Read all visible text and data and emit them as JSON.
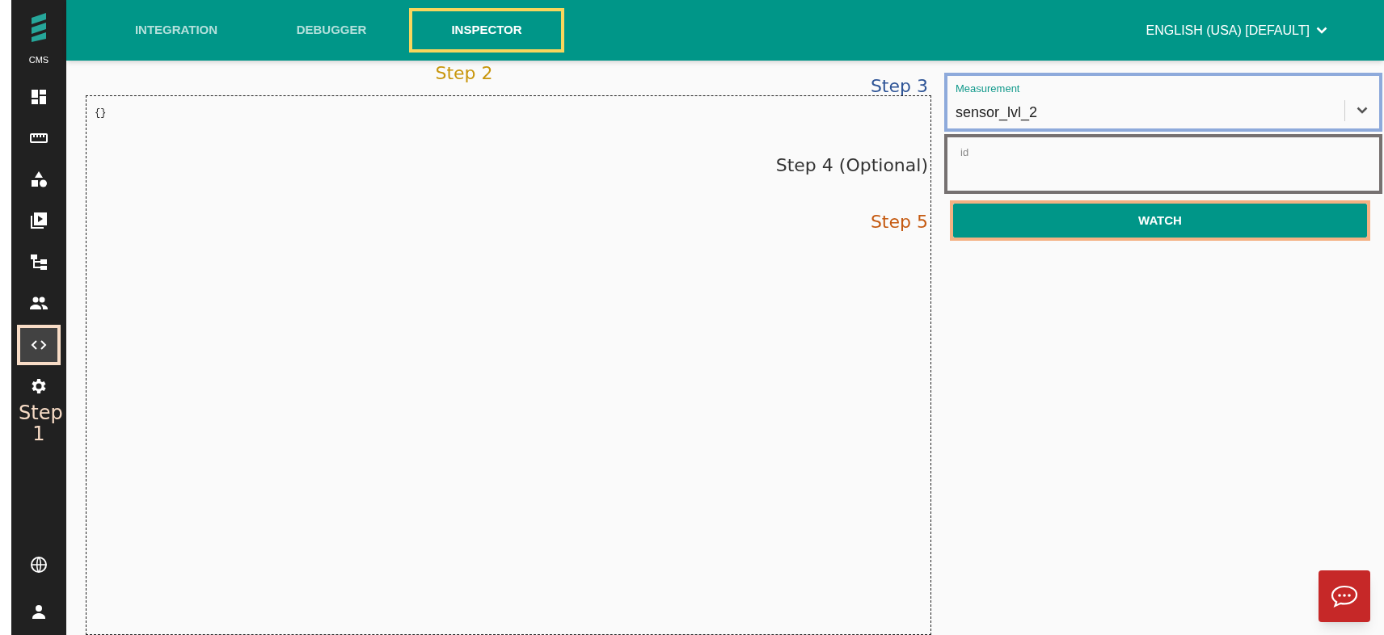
{
  "sidebar": {
    "logo_text": "CMS",
    "items": [
      {
        "selected": false
      },
      {
        "selected": false
      },
      {
        "selected": false
      },
      {
        "selected": false
      },
      {
        "selected": false
      },
      {
        "selected": false
      },
      {
        "selected": true
      },
      {
        "selected": false
      }
    ],
    "bottom_items": [
      {
        "selected": false
      },
      {
        "selected": false
      }
    ]
  },
  "tabs": [
    {
      "label": "INTEGRATION",
      "selected": false
    },
    {
      "label": "DEBUGGER",
      "selected": false
    },
    {
      "label": "INSPECTOR",
      "selected": true
    }
  ],
  "language": "ENGLISH (USA) [DEFAULT]",
  "editor": {
    "content": "{}"
  },
  "measurement": {
    "label": "Measurement",
    "value": "sensor_lvl_2"
  },
  "id_field": {
    "placeholder": "id"
  },
  "watch_button": "WATCH",
  "annotations": [
    {
      "text": "Step 1",
      "color": "#f8dcc6"
    },
    {
      "text": "Step 2",
      "color": "#c8960c"
    },
    {
      "text": "Step 3",
      "color": "#2f5597"
    },
    {
      "text": "Step 4 (Optional)",
      "color": "#333333"
    },
    {
      "text": "Step 5",
      "color": "#c55a11"
    }
  ],
  "highlights": [
    {
      "color": "#f8dcc6"
    },
    {
      "color": "#f9d65c"
    },
    {
      "color": "#8eaadb"
    },
    {
      "color": "#767171"
    },
    {
      "color": "#f4b183"
    }
  ]
}
